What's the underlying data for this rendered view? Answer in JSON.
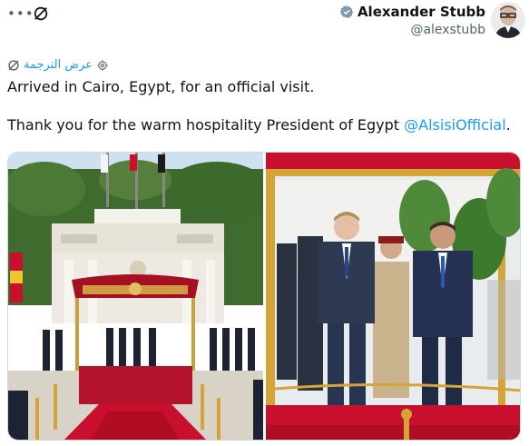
{
  "author": {
    "name": "Alexander Stubb",
    "handle": "@alexstubb"
  },
  "translate": {
    "label": "عرض الترجمة"
  },
  "tweet": {
    "line1": "Arrived in Cairo, Egypt, for an official visit.",
    "line2_prefix": "Thank you for the warm hospitality President of Egypt ",
    "mention": "@AlsisiOfficial",
    "line2_suffix": "."
  },
  "icons": {
    "more": "more-icon",
    "grok": "grok-icon",
    "verified": "verified-badge-icon",
    "translate": "translate-globe-icon"
  },
  "colors": {
    "accent": "#1d9bf0",
    "text": "#0f1419",
    "secondary": "#536471",
    "carpet": "#c8102e"
  }
}
